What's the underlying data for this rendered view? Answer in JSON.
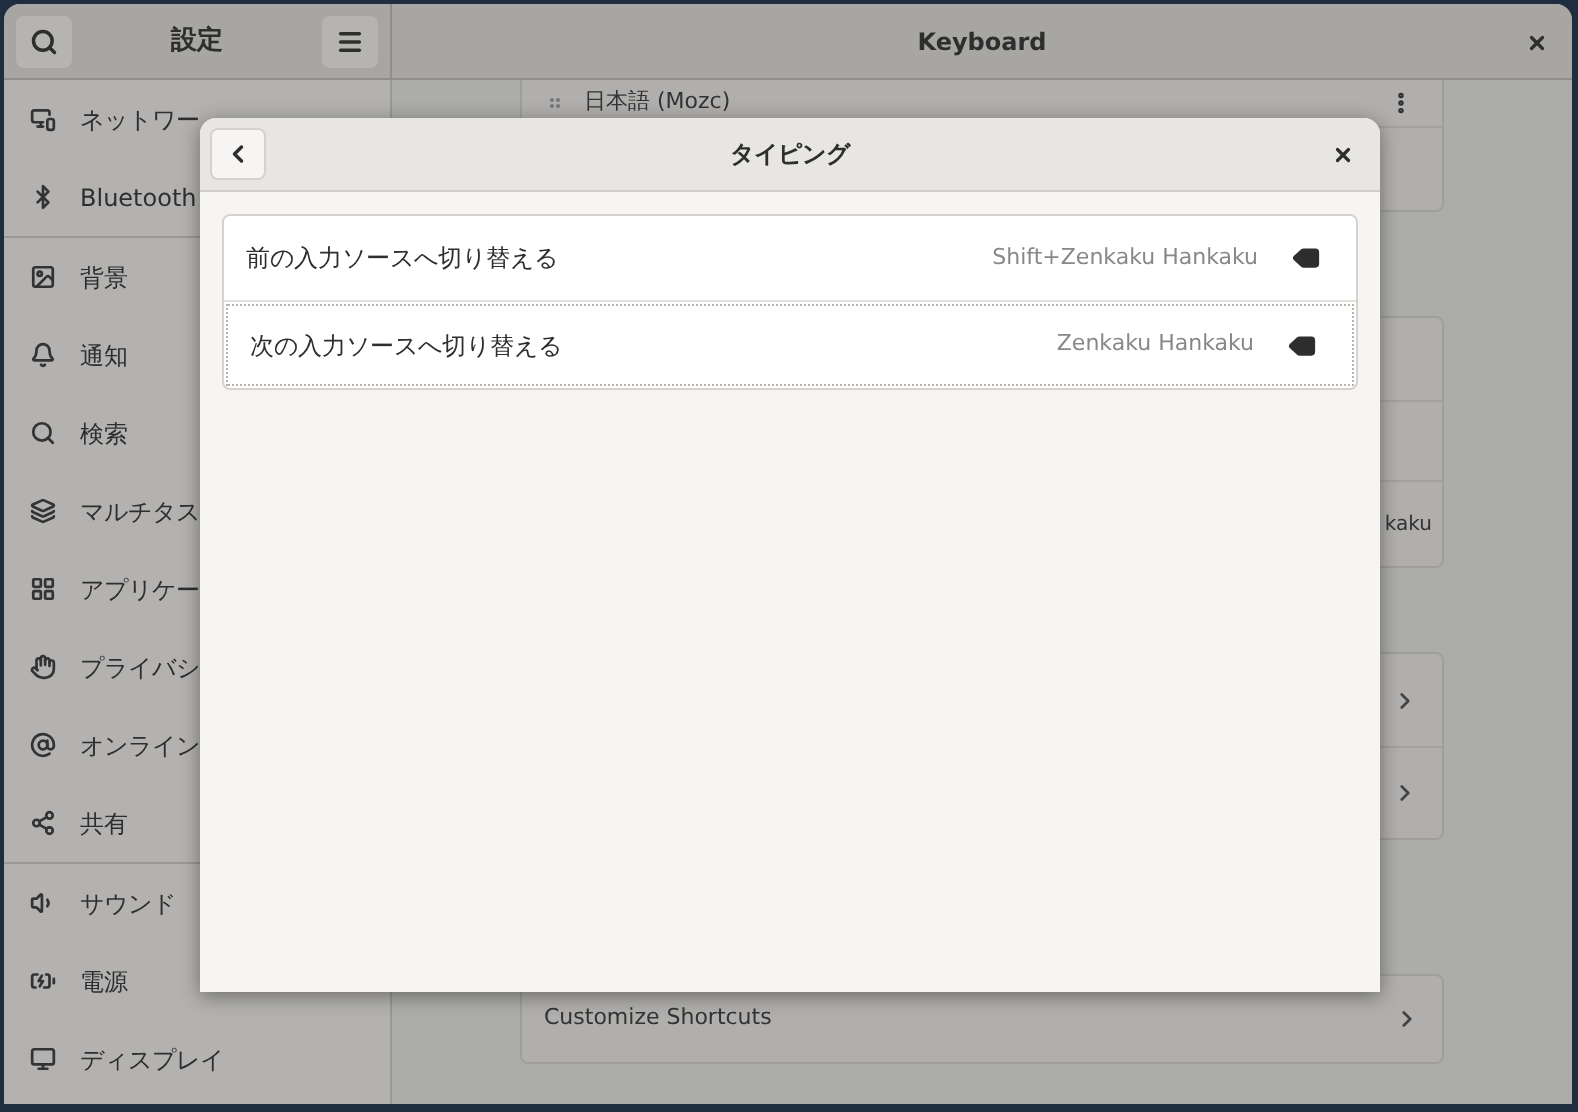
{
  "window": {
    "title": "Keyboard"
  },
  "sidebar": {
    "title": "設定",
    "groups": [
      [
        {
          "label": "ネットワー"
        },
        {
          "label": "Bluetooth"
        }
      ],
      [
        {
          "label": "背景"
        },
        {
          "label": "通知"
        },
        {
          "label": "検索"
        },
        {
          "label": "マルチタス"
        },
        {
          "label": "アプリケー"
        },
        {
          "label": "プライバシ"
        },
        {
          "label": "オンライン"
        },
        {
          "label": "共有"
        }
      ],
      [
        {
          "label": "サウンド"
        },
        {
          "label": "電源"
        },
        {
          "label": "ディスプレイ"
        }
      ]
    ]
  },
  "content": {
    "input_source": "日本語 (Mozc)",
    "shortcut_reading": "kaku",
    "customize": "Customize Shortcuts"
  },
  "dialog": {
    "title": "タイピング",
    "shortcuts": [
      {
        "label": "前の入力ソースへ切り替える",
        "accel": "Shift+Zenkaku Hankaku",
        "focused": false
      },
      {
        "label": "次の入力ソースへ切り替える",
        "accel": "Zenkaku Hankaku",
        "focused": true
      }
    ]
  }
}
